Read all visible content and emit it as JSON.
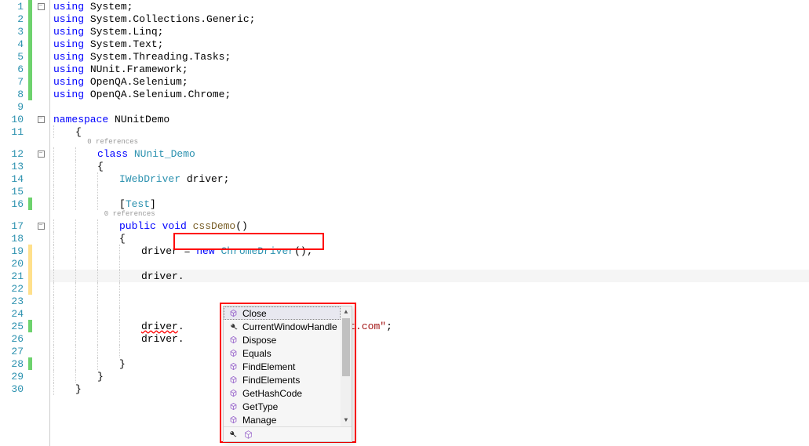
{
  "lines": [
    {
      "num": 1,
      "mark": "green",
      "fold": "minus",
      "text": "",
      "tokens": [
        {
          "t": "using ",
          "c": "kw"
        },
        {
          "t": "System;",
          "c": ""
        }
      ]
    },
    {
      "num": 2,
      "mark": "green",
      "text": "",
      "tokens": [
        {
          "t": "using ",
          "c": "kw"
        },
        {
          "t": "System.Collections.Generic;",
          "c": ""
        }
      ]
    },
    {
      "num": 3,
      "mark": "green",
      "text": "",
      "tokens": [
        {
          "t": "using ",
          "c": "kw"
        },
        {
          "t": "System.Linq;",
          "c": ""
        }
      ]
    },
    {
      "num": 4,
      "mark": "green",
      "text": "",
      "tokens": [
        {
          "t": "using ",
          "c": "kw"
        },
        {
          "t": "System.Text;",
          "c": ""
        }
      ]
    },
    {
      "num": 5,
      "mark": "green",
      "text": "",
      "tokens": [
        {
          "t": "using ",
          "c": "kw"
        },
        {
          "t": "System.Threading.Tasks;",
          "c": ""
        }
      ]
    },
    {
      "num": 6,
      "mark": "green",
      "text": "",
      "tokens": [
        {
          "t": "using ",
          "c": "kw"
        },
        {
          "t": "NUnit.Framework;",
          "c": ""
        }
      ]
    },
    {
      "num": 7,
      "mark": "green",
      "text": "",
      "tokens": [
        {
          "t": "using ",
          "c": "kw"
        },
        {
          "t": "OpenQA.Selenium;",
          "c": ""
        }
      ]
    },
    {
      "num": 8,
      "mark": "green",
      "text": "",
      "tokens": [
        {
          "t": "using ",
          "c": "kw"
        },
        {
          "t": "OpenQA.Selenium.Chrome;",
          "c": ""
        }
      ]
    },
    {
      "num": 9,
      "text": "",
      "tokens": []
    },
    {
      "num": 10,
      "fold": "minus",
      "text": "",
      "tokens": [
        {
          "t": "namespace ",
          "c": "kw"
        },
        {
          "t": "NUnitDemo",
          "c": ""
        }
      ]
    },
    {
      "num": 11,
      "indent": 0,
      "text": "",
      "tokens": [
        {
          "t": "{",
          "c": ""
        }
      ]
    },
    {
      "codelens": true,
      "indent": 1,
      "text": "0 references"
    },
    {
      "num": 12,
      "fold": "minus",
      "indent": 1,
      "text": "",
      "tokens": [
        {
          "t": "class ",
          "c": "kw"
        },
        {
          "t": "NUnit_Demo",
          "c": "type"
        }
      ]
    },
    {
      "num": 13,
      "indent": 1,
      "text": "",
      "tokens": [
        {
          "t": "{",
          "c": ""
        }
      ]
    },
    {
      "num": 14,
      "indent": 2,
      "text": "",
      "tokens": [
        {
          "t": "IWebDriver",
          "c": "type"
        },
        {
          "t": " driver;",
          "c": ""
        }
      ]
    },
    {
      "num": 15,
      "indent": 2,
      "text": "",
      "tokens": []
    },
    {
      "num": 16,
      "mark": "green",
      "indent": 2,
      "text": "",
      "tokens": [
        {
          "t": "[",
          "c": ""
        },
        {
          "t": "Test",
          "c": "type"
        },
        {
          "t": "]",
          "c": ""
        }
      ]
    },
    {
      "codelens": true,
      "indent": 2,
      "text": "0 references"
    },
    {
      "num": 17,
      "fold": "minus",
      "indent": 2,
      "text": "",
      "tokens": [
        {
          "t": "public ",
          "c": "kw"
        },
        {
          "t": "void ",
          "c": "kw"
        },
        {
          "t": "cssDemo",
          "c": "method"
        },
        {
          "t": "()",
          "c": ""
        }
      ]
    },
    {
      "num": 18,
      "indent": 2,
      "text": "",
      "tokens": [
        {
          "t": "{",
          "c": ""
        }
      ]
    },
    {
      "num": 19,
      "mark": "yellow",
      "indent": 3,
      "text": "",
      "tokens": [
        {
          "t": "driver = ",
          "c": ""
        },
        {
          "t": "new ",
          "c": "kw"
        },
        {
          "t": "ChromeDriver",
          "c": "type"
        },
        {
          "t": "();",
          "c": ""
        }
      ]
    },
    {
      "num": 20,
      "mark": "yellow",
      "indent": 3,
      "text": "",
      "tokens": []
    },
    {
      "num": 21,
      "mark": "yellow",
      "active": true,
      "indent": 3,
      "text": "",
      "tokens": [
        {
          "t": "driver.",
          "c": ""
        }
      ]
    },
    {
      "num": 22,
      "mark": "yellow",
      "indent": 3,
      "text": "",
      "tokens": []
    },
    {
      "num": 23,
      "indent": 3,
      "text": "",
      "tokens": []
    },
    {
      "num": 24,
      "indent": 3,
      "text": "",
      "tokens": []
    },
    {
      "num": 25,
      "mark": "green",
      "indent": 3,
      "text": "",
      "tokens": [
        {
          "t": "driver",
          "c": "err"
        },
        {
          "t": ".                      ",
          "c": ""
        },
        {
          "t": "latest.com\"",
          "c": "str"
        },
        {
          "t": ";",
          "c": ""
        }
      ]
    },
    {
      "num": 26,
      "indent": 3,
      "text": "",
      "tokens": [
        {
          "t": "driver.                      ();",
          "c": ""
        }
      ]
    },
    {
      "num": 27,
      "indent": 3,
      "text": "",
      "tokens": []
    },
    {
      "num": 28,
      "mark": "green",
      "indent": 2,
      "text": "",
      "tokens": [
        {
          "t": "}",
          "c": ""
        }
      ]
    },
    {
      "num": 29,
      "indent": 1,
      "text": "",
      "tokens": [
        {
          "t": "}",
          "c": ""
        }
      ]
    },
    {
      "num": 30,
      "indent": 0,
      "text": "",
      "tokens": [
        {
          "t": "}",
          "c": ""
        }
      ]
    }
  ],
  "intellisense": {
    "items": [
      {
        "icon": "cube",
        "label": "Close",
        "selected": true
      },
      {
        "icon": "wrench",
        "label": "CurrentWindowHandle"
      },
      {
        "icon": "cube",
        "label": "Dispose"
      },
      {
        "icon": "cube",
        "label": "Equals"
      },
      {
        "icon": "cube",
        "label": "FindElement"
      },
      {
        "icon": "cube",
        "label": "FindElements"
      },
      {
        "icon": "cube",
        "label": "GetHashCode"
      },
      {
        "icon": "cube",
        "label": "GetType"
      },
      {
        "icon": "cube",
        "label": "Manage"
      }
    ]
  }
}
